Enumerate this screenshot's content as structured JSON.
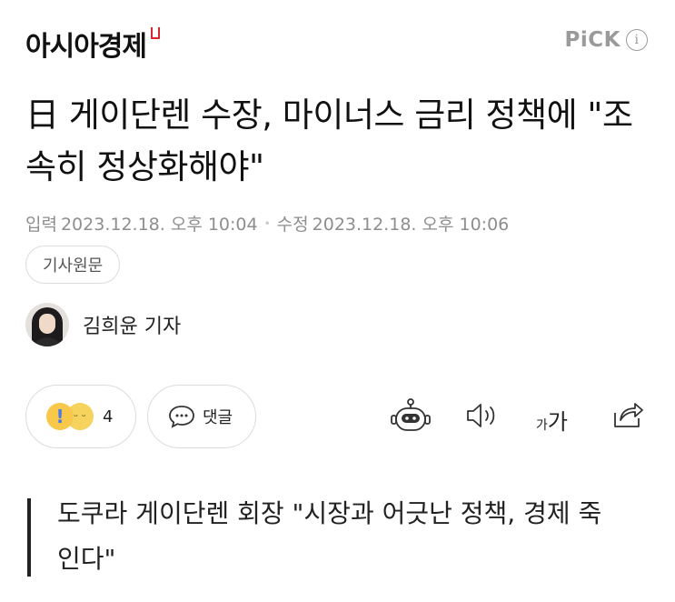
{
  "header": {
    "press_name": "아시아경제",
    "pick_label": "PiCK",
    "info_glyph": "i"
  },
  "article": {
    "headline": "日 게이단렌 수장, 마이너스 금리 정책에 \"조속히 정상화해야\"",
    "input_label": "입력",
    "input_date": "2023.12.18. 오후 10:04",
    "modified_label": "수정",
    "modified_date": "2023.12.18. 오후 10:06",
    "separator": "•",
    "origin_button_label": "기사원문",
    "reporter": "김희윤 기자",
    "subtitle": "도쿠라 게이단렌 회장 \"시장과 어긋난 정책, 경제 죽인다\""
  },
  "toolbar": {
    "reaction_count": "4",
    "comment_label": "댓글",
    "font_small": "가",
    "font_large": "가"
  },
  "icons": {
    "press_logo": "asiae-logo-mark",
    "pick_info": "info-icon",
    "reaction_1": "surprise-emoji-icon",
    "reaction_2": "sleepy-emoji-icon",
    "comment": "speech-bubble-icon",
    "summary_bot": "robot-icon",
    "tts": "speaker-icon",
    "share": "share-icon"
  },
  "colors": {
    "brand_red": "#d8262e",
    "text": "#111111",
    "meta_gray": "#8e8e8e",
    "border": "#dcdcdc"
  }
}
